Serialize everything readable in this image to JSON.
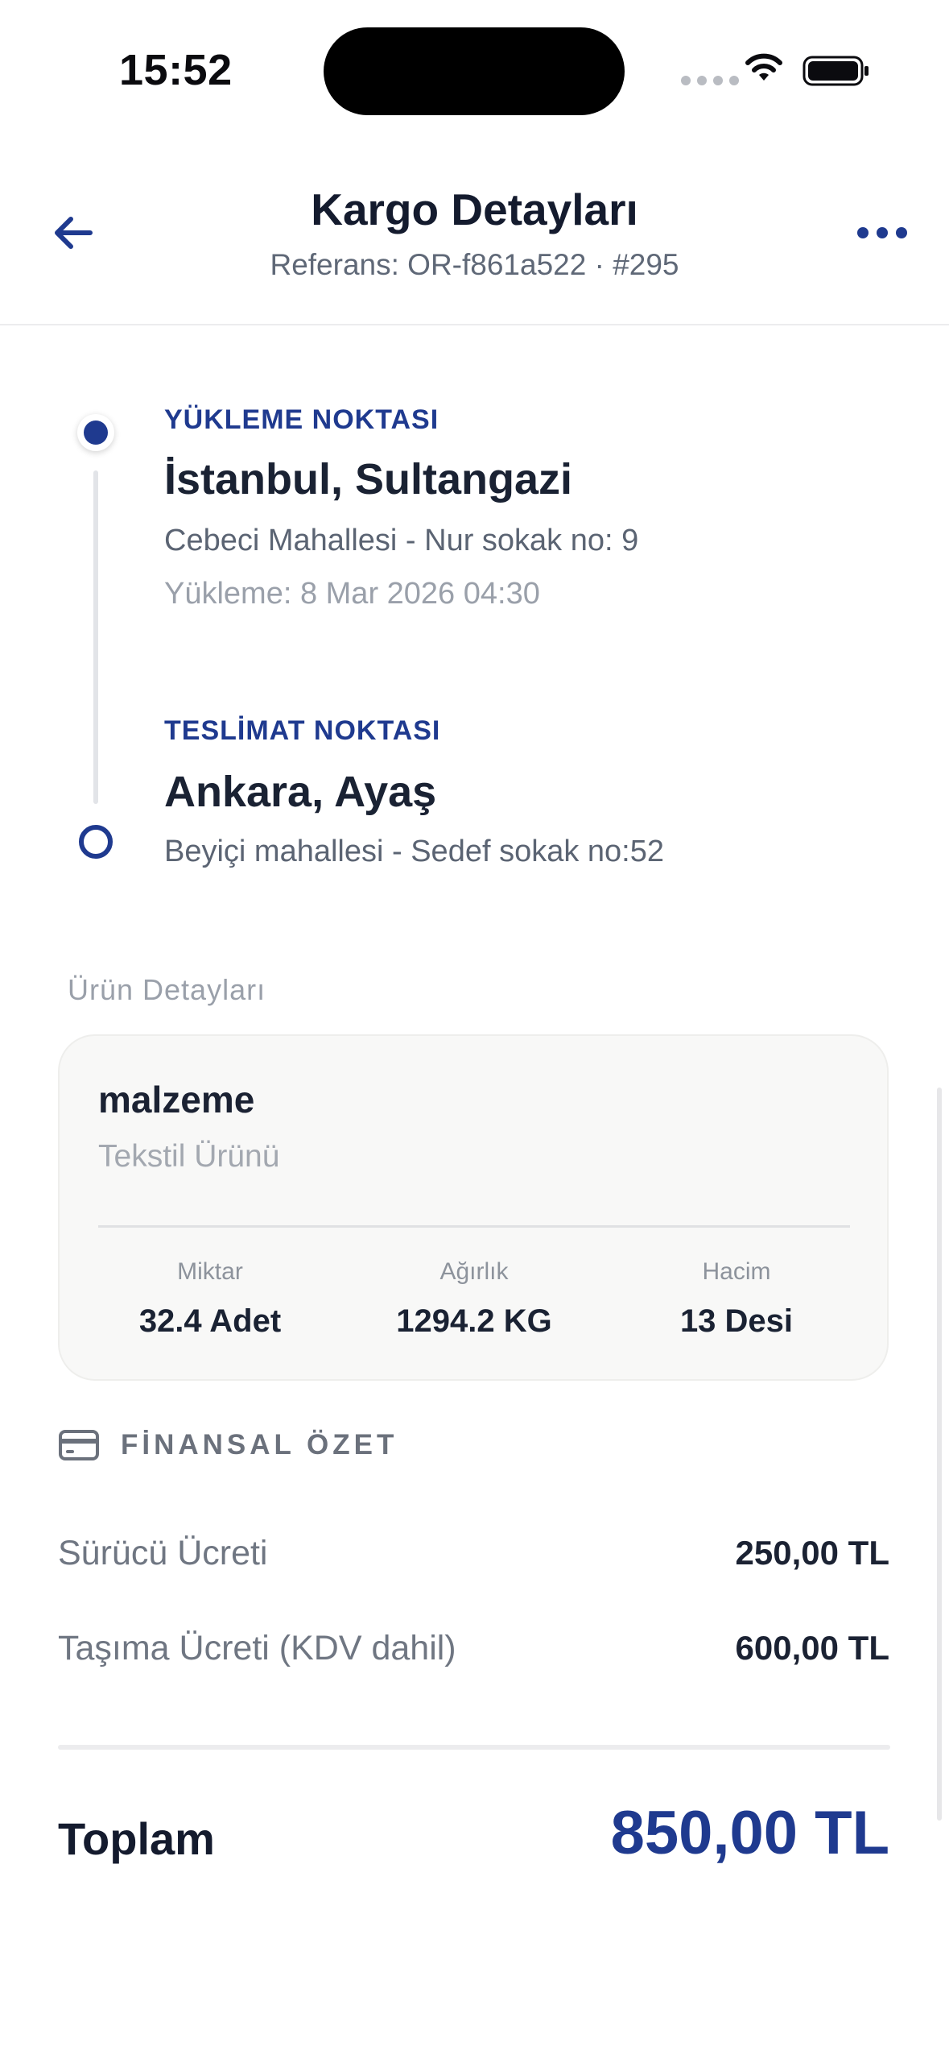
{
  "status_bar": {
    "time": "15:52"
  },
  "header": {
    "title": "Kargo Detayları",
    "subtitle": "Referans: OR-f861a522 · #295",
    "back_icon": "arrow-left-icon",
    "more_icon": "more-horizontal-icon"
  },
  "route": {
    "pickup": {
      "label": "YÜKLEME NOKTASI",
      "city": "İstanbul, Sultangazi",
      "address": "Cebeci Mahallesi - Nur sokak no: 9",
      "date": "Yükleme: 8 Mar 2026 04:30"
    },
    "delivery": {
      "label": "TESLİMAT NOKTASI",
      "city": "Ankara, Ayaş",
      "address": "Beyiçi mahallesi - Sedef sokak no:52"
    }
  },
  "product": {
    "section_title": "Ürün Detayları",
    "name": "malzeme",
    "category": "Tekstil Ürünü",
    "metrics": [
      {
        "label": "Miktar",
        "value": "32.4 Adet"
      },
      {
        "label": "Ağırlık",
        "value": "1294.2 KG"
      },
      {
        "label": "Hacim",
        "value": "13 Desi"
      }
    ]
  },
  "finance": {
    "heading": "FİNANSAL ÖZET",
    "icon": "credit-card-icon",
    "rows": [
      {
        "label": "Sürücü Ücreti",
        "value": "250,00 TL"
      },
      {
        "label": "Taşıma Ücreti (KDV dahil)",
        "value": "600,00 TL"
      }
    ],
    "total_label": "Toplam",
    "total_value": "850,00 TL"
  },
  "colors": {
    "accent": "#1f3a8f",
    "text_primary": "#1a2233",
    "text_secondary": "#5b6473",
    "card_background": "#f8f8f7"
  }
}
